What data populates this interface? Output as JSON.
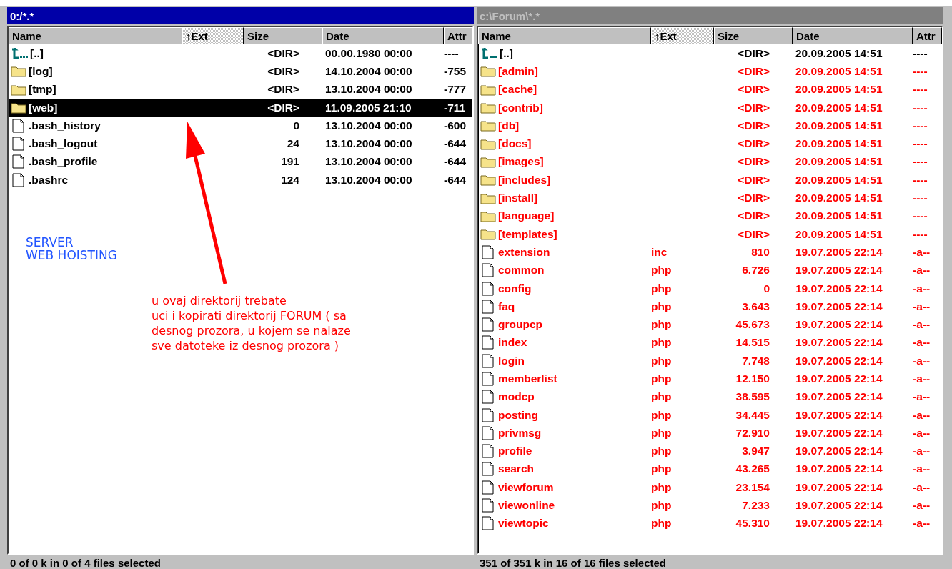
{
  "panels": [
    {
      "title": "0:/*.*",
      "active": true,
      "columns": [
        {
          "label": "Name",
          "sorted": false
        },
        {
          "label": "↑Ext",
          "sorted": true
        },
        {
          "label": "Size",
          "sorted": false
        },
        {
          "label": "Date",
          "sorted": false
        },
        {
          "label": "Attr",
          "sorted": false
        }
      ],
      "rows": [
        {
          "kind": "up",
          "name": "[..]",
          "size": "<DIR>",
          "date": "00.00.1980 00:00",
          "attr": "----",
          "selected": false,
          "marked": false
        },
        {
          "kind": "folder",
          "name": "[log]",
          "size": "<DIR>",
          "date": "14.10.2004 00:00",
          "attr": "-755",
          "selected": false,
          "marked": false
        },
        {
          "kind": "folder",
          "name": "[tmp]",
          "size": "<DIR>",
          "date": "13.10.2004 00:00",
          "attr": "-777",
          "selected": false,
          "marked": false
        },
        {
          "kind": "folder",
          "name": "[web]",
          "size": "<DIR>",
          "date": "11.09.2005 21:10",
          "attr": "-711",
          "selected": true,
          "marked": false
        },
        {
          "kind": "file",
          "name": ".bash_history",
          "size": "0",
          "date": "13.10.2004 00:00",
          "attr": "-600",
          "selected": false,
          "marked": false
        },
        {
          "kind": "file",
          "name": ".bash_logout",
          "size": "24",
          "date": "13.10.2004 00:00",
          "attr": "-644",
          "selected": false,
          "marked": false
        },
        {
          "kind": "file",
          "name": ".bash_profile",
          "size": "191",
          "date": "13.10.2004 00:00",
          "attr": "-644",
          "selected": false,
          "marked": false
        },
        {
          "kind": "file",
          "name": ".bashrc",
          "size": "124",
          "date": "13.10.2004 00:00",
          "attr": "-644",
          "selected": false,
          "marked": false
        }
      ],
      "status": "0 of 0 k in 0 of 4 files selected",
      "annotations": {
        "server_label": [
          "SERVER",
          "WEB HOISTING"
        ],
        "note": [
          "u ovaj direktorij trebate",
          "uci i kopirati direktorij FORUM  ( sa",
          "desnog prozora, u kojem se nalaze",
          "sve datoteke iz desnog prozora )"
        ]
      }
    },
    {
      "title": "c:\\Forum\\*.*",
      "active": false,
      "columns": [
        {
          "label": "Name",
          "sorted": false
        },
        {
          "label": "↑Ext",
          "sorted": true
        },
        {
          "label": "Size",
          "sorted": false
        },
        {
          "label": "Date",
          "sorted": false
        },
        {
          "label": "Attr",
          "sorted": false
        }
      ],
      "rows": [
        {
          "kind": "up",
          "name": "[..]",
          "size": "<DIR>",
          "date": "20.09.2005 14:51",
          "attr": "----",
          "selected": false,
          "marked": false
        },
        {
          "kind": "folder",
          "name": "[admin]",
          "size": "<DIR>",
          "date": "20.09.2005 14:51",
          "attr": "----",
          "selected": false,
          "marked": true
        },
        {
          "kind": "folder",
          "name": "[cache]",
          "size": "<DIR>",
          "date": "20.09.2005 14:51",
          "attr": "----",
          "selected": false,
          "marked": true
        },
        {
          "kind": "folder",
          "name": "[contrib]",
          "size": "<DIR>",
          "date": "20.09.2005 14:51",
          "attr": "----",
          "selected": false,
          "marked": true
        },
        {
          "kind": "folder",
          "name": "[db]",
          "size": "<DIR>",
          "date": "20.09.2005 14:51",
          "attr": "----",
          "selected": false,
          "marked": true
        },
        {
          "kind": "folder",
          "name": "[docs]",
          "size": "<DIR>",
          "date": "20.09.2005 14:51",
          "attr": "----",
          "selected": false,
          "marked": true
        },
        {
          "kind": "folder",
          "name": "[images]",
          "size": "<DIR>",
          "date": "20.09.2005 14:51",
          "attr": "----",
          "selected": false,
          "marked": true
        },
        {
          "kind": "folder",
          "name": "[includes]",
          "size": "<DIR>",
          "date": "20.09.2005 14:51",
          "attr": "----",
          "selected": false,
          "marked": true
        },
        {
          "kind": "folder",
          "name": "[install]",
          "size": "<DIR>",
          "date": "20.09.2005 14:51",
          "attr": "----",
          "selected": false,
          "marked": true
        },
        {
          "kind": "folder",
          "name": "[language]",
          "size": "<DIR>",
          "date": "20.09.2005 14:51",
          "attr": "----",
          "selected": false,
          "marked": true
        },
        {
          "kind": "folder",
          "name": "[templates]",
          "size": "<DIR>",
          "date": "20.09.2005 14:51",
          "attr": "----",
          "selected": false,
          "marked": true
        },
        {
          "kind": "file",
          "name": "extension",
          "ext": "inc",
          "size": "810",
          "date": "19.07.2005 22:14",
          "attr": "-a--",
          "selected": false,
          "marked": true
        },
        {
          "kind": "file",
          "name": "common",
          "ext": "php",
          "size": "6.726",
          "date": "19.07.2005 22:14",
          "attr": "-a--",
          "selected": false,
          "marked": true
        },
        {
          "kind": "file",
          "name": "config",
          "ext": "php",
          "size": "0",
          "date": "19.07.2005 22:14",
          "attr": "-a--",
          "selected": false,
          "marked": true
        },
        {
          "kind": "file",
          "name": "faq",
          "ext": "php",
          "size": "3.643",
          "date": "19.07.2005 22:14",
          "attr": "-a--",
          "selected": false,
          "marked": true
        },
        {
          "kind": "file",
          "name": "groupcp",
          "ext": "php",
          "size": "45.673",
          "date": "19.07.2005 22:14",
          "attr": "-a--",
          "selected": false,
          "marked": true
        },
        {
          "kind": "file",
          "name": "index",
          "ext": "php",
          "size": "14.515",
          "date": "19.07.2005 22:14",
          "attr": "-a--",
          "selected": false,
          "marked": true
        },
        {
          "kind": "file",
          "name": "login",
          "ext": "php",
          "size": "7.748",
          "date": "19.07.2005 22:14",
          "attr": "-a--",
          "selected": false,
          "marked": true
        },
        {
          "kind": "file",
          "name": "memberlist",
          "ext": "php",
          "size": "12.150",
          "date": "19.07.2005 22:14",
          "attr": "-a--",
          "selected": false,
          "marked": true
        },
        {
          "kind": "file",
          "name": "modcp",
          "ext": "php",
          "size": "38.595",
          "date": "19.07.2005 22:14",
          "attr": "-a--",
          "selected": false,
          "marked": true
        },
        {
          "kind": "file",
          "name": "posting",
          "ext": "php",
          "size": "34.445",
          "date": "19.07.2005 22:14",
          "attr": "-a--",
          "selected": false,
          "marked": true
        },
        {
          "kind": "file",
          "name": "privmsg",
          "ext": "php",
          "size": "72.910",
          "date": "19.07.2005 22:14",
          "attr": "-a--",
          "selected": false,
          "marked": true
        },
        {
          "kind": "file",
          "name": "profile",
          "ext": "php",
          "size": "3.947",
          "date": "19.07.2005 22:14",
          "attr": "-a--",
          "selected": false,
          "marked": true
        },
        {
          "kind": "file",
          "name": "search",
          "ext": "php",
          "size": "43.265",
          "date": "19.07.2005 22:14",
          "attr": "-a--",
          "selected": false,
          "marked": true
        },
        {
          "kind": "file",
          "name": "viewforum",
          "ext": "php",
          "size": "23.154",
          "date": "19.07.2005 22:14",
          "attr": "-a--",
          "selected": false,
          "marked": true
        },
        {
          "kind": "file",
          "name": "viewonline",
          "ext": "php",
          "size": "7.233",
          "date": "19.07.2005 22:14",
          "attr": "-a--",
          "selected": false,
          "marked": true
        },
        {
          "kind": "file",
          "name": "viewtopic",
          "ext": "php",
          "size": "45.310",
          "date": "19.07.2005 22:14",
          "attr": "-a--",
          "selected": false,
          "marked": true
        }
      ],
      "status": "351 of 351 k in 16 of 16 files selected"
    }
  ]
}
